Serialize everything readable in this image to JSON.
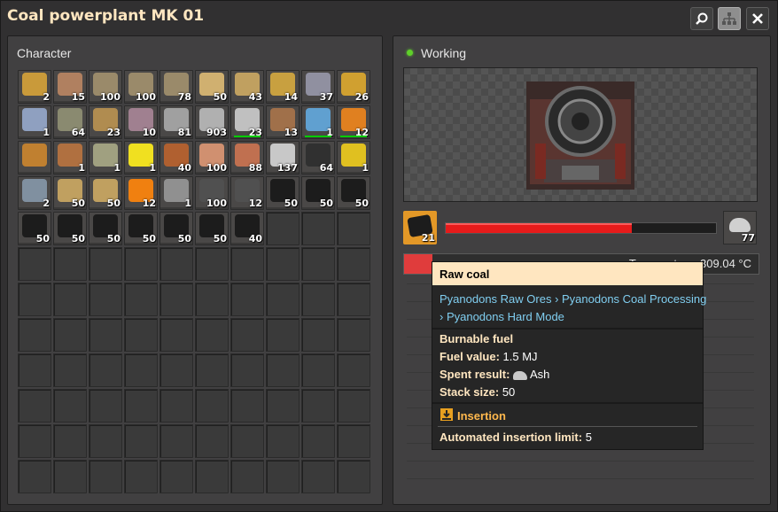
{
  "window": {
    "title": "Coal powerplant MK 01"
  },
  "character_panel": {
    "label": "Character",
    "slots": [
      {
        "icon": "crate-icon",
        "color": "#c99a3a",
        "count": "2"
      },
      {
        "icon": "wooden-chest-icon",
        "color": "#b08060",
        "count": "15"
      },
      {
        "icon": "belt-icon",
        "color": "#9a8a6a",
        "count": "100"
      },
      {
        "icon": "belt-icon",
        "color": "#9a8a6a",
        "count": "100"
      },
      {
        "icon": "belt-icon",
        "color": "#9a8a6a",
        "count": "78"
      },
      {
        "icon": "loader-icon",
        "color": "#d0b070",
        "count": "50"
      },
      {
        "icon": "splitter-icon",
        "color": "#c0a060",
        "count": "43"
      },
      {
        "icon": "inserter-icon",
        "color": "#c8a040",
        "count": "14"
      },
      {
        "icon": "long-inserter-icon",
        "color": "#9090a0",
        "count": "37"
      },
      {
        "icon": "fast-inserter-icon",
        "color": "#d0a030",
        "count": "26"
      },
      {
        "icon": "lab-icon",
        "color": "#8fa0c0",
        "count": "1"
      },
      {
        "icon": "pipe-icon",
        "color": "#8a8a70",
        "count": "64"
      },
      {
        "icon": "pipe-segment-icon",
        "color": "#b08c50",
        "count": "23"
      },
      {
        "icon": "fence-icon",
        "color": "#a08090",
        "count": "10"
      },
      {
        "icon": "stone-brick-icon",
        "color": "#a0a0a0",
        "count": "81"
      },
      {
        "icon": "concrete-icon",
        "color": "#b0b0b0",
        "count": "903"
      },
      {
        "icon": "repair-tool-icon",
        "color": "#c0c0c0",
        "count": "23",
        "bar": true
      },
      {
        "icon": "assembler-icon",
        "color": "#a0704a",
        "count": "13"
      },
      {
        "icon": "toolbox-icon",
        "color": "#60a0d0",
        "count": "1",
        "bar": true
      },
      {
        "icon": "potion-icon",
        "color": "#e08020",
        "count": "12",
        "bar": true
      },
      {
        "icon": "lamp-icon",
        "color": "#c08030",
        "count": ""
      },
      {
        "icon": "gear-assembly-icon",
        "color": "#b07040",
        "count": "1"
      },
      {
        "icon": "drill-icon",
        "color": "#a0a080",
        "count": "1"
      },
      {
        "icon": "flask-icon",
        "color": "#f0e020",
        "count": "1"
      },
      {
        "icon": "wood-icon",
        "color": "#b06030",
        "count": "40"
      },
      {
        "icon": "log-icon",
        "color": "#d09070",
        "count": "100"
      },
      {
        "icon": "plank-icon",
        "color": "#c07050",
        "count": "88"
      },
      {
        "icon": "ash-icon",
        "color": "#c8c8c8",
        "count": "137"
      },
      {
        "icon": "coal-bag-icon",
        "color": "#303030",
        "count": "64"
      },
      {
        "icon": "coin-icon",
        "color": "#e0c020",
        "count": "1"
      },
      {
        "icon": "cage-icon",
        "color": "#8090a0",
        "count": "2"
      },
      {
        "icon": "ore-icon",
        "color": "#c0a060",
        "count": "50"
      },
      {
        "icon": "ore-icon",
        "color": "#c0a060",
        "count": "50"
      },
      {
        "icon": "orange-orb-icon",
        "color": "#f08010",
        "count": "12"
      },
      {
        "icon": "chain-icon",
        "color": "#909090",
        "count": "1"
      },
      {
        "icon": "rock-icon",
        "color": "#505050",
        "count": "100"
      },
      {
        "icon": "rock-icon",
        "color": "#505050",
        "count": "12"
      },
      {
        "icon": "raw-coal-icon",
        "color": "#1c1c1c",
        "count": "50"
      },
      {
        "icon": "raw-coal-icon",
        "color": "#1c1c1c",
        "count": "50"
      },
      {
        "icon": "raw-coal-icon",
        "color": "#1c1c1c",
        "count": "50"
      },
      {
        "icon": "raw-coal-icon",
        "color": "#1c1c1c",
        "count": "50"
      },
      {
        "icon": "raw-coal-icon",
        "color": "#1c1c1c",
        "count": "50"
      },
      {
        "icon": "raw-coal-icon",
        "color": "#1c1c1c",
        "count": "50"
      },
      {
        "icon": "raw-coal-icon",
        "color": "#1c1c1c",
        "count": "50"
      },
      {
        "icon": "raw-coal-icon",
        "color": "#1c1c1c",
        "count": "50"
      },
      {
        "icon": "raw-coal-icon",
        "color": "#1c1c1c",
        "count": "50"
      },
      {
        "icon": "raw-coal-icon",
        "color": "#1c1c1c",
        "count": "40"
      }
    ],
    "total_slots": 120
  },
  "entity_panel": {
    "status": "Working",
    "status_color": "#5fd02a",
    "fuel_slot": {
      "icon": "raw-coal-icon",
      "count": "21"
    },
    "burn_progress": 0.69,
    "result_slot": {
      "icon": "ash-icon",
      "count": "77"
    },
    "temperature_text": "Temperature: 309.04 °C",
    "temperature_fill": 0.08
  },
  "tooltip": {
    "title": "Raw coal",
    "breadcrumb_line1": "Pyanodons Raw Ores › Pyanodons Coal Processing",
    "breadcrumb_line2": "› Pyanodons Hard Mode",
    "burnable_fuel": "Burnable fuel",
    "fuel_value_label": "Fuel value:",
    "fuel_value": "1.5 MJ",
    "spent_result_label": "Spent result:",
    "spent_result": "Ash",
    "stack_size_label": "Stack size:",
    "stack_size": "50",
    "insertion_title": "Insertion",
    "insertion_limit_label": "Automated insertion limit:",
    "insertion_limit": "5"
  }
}
